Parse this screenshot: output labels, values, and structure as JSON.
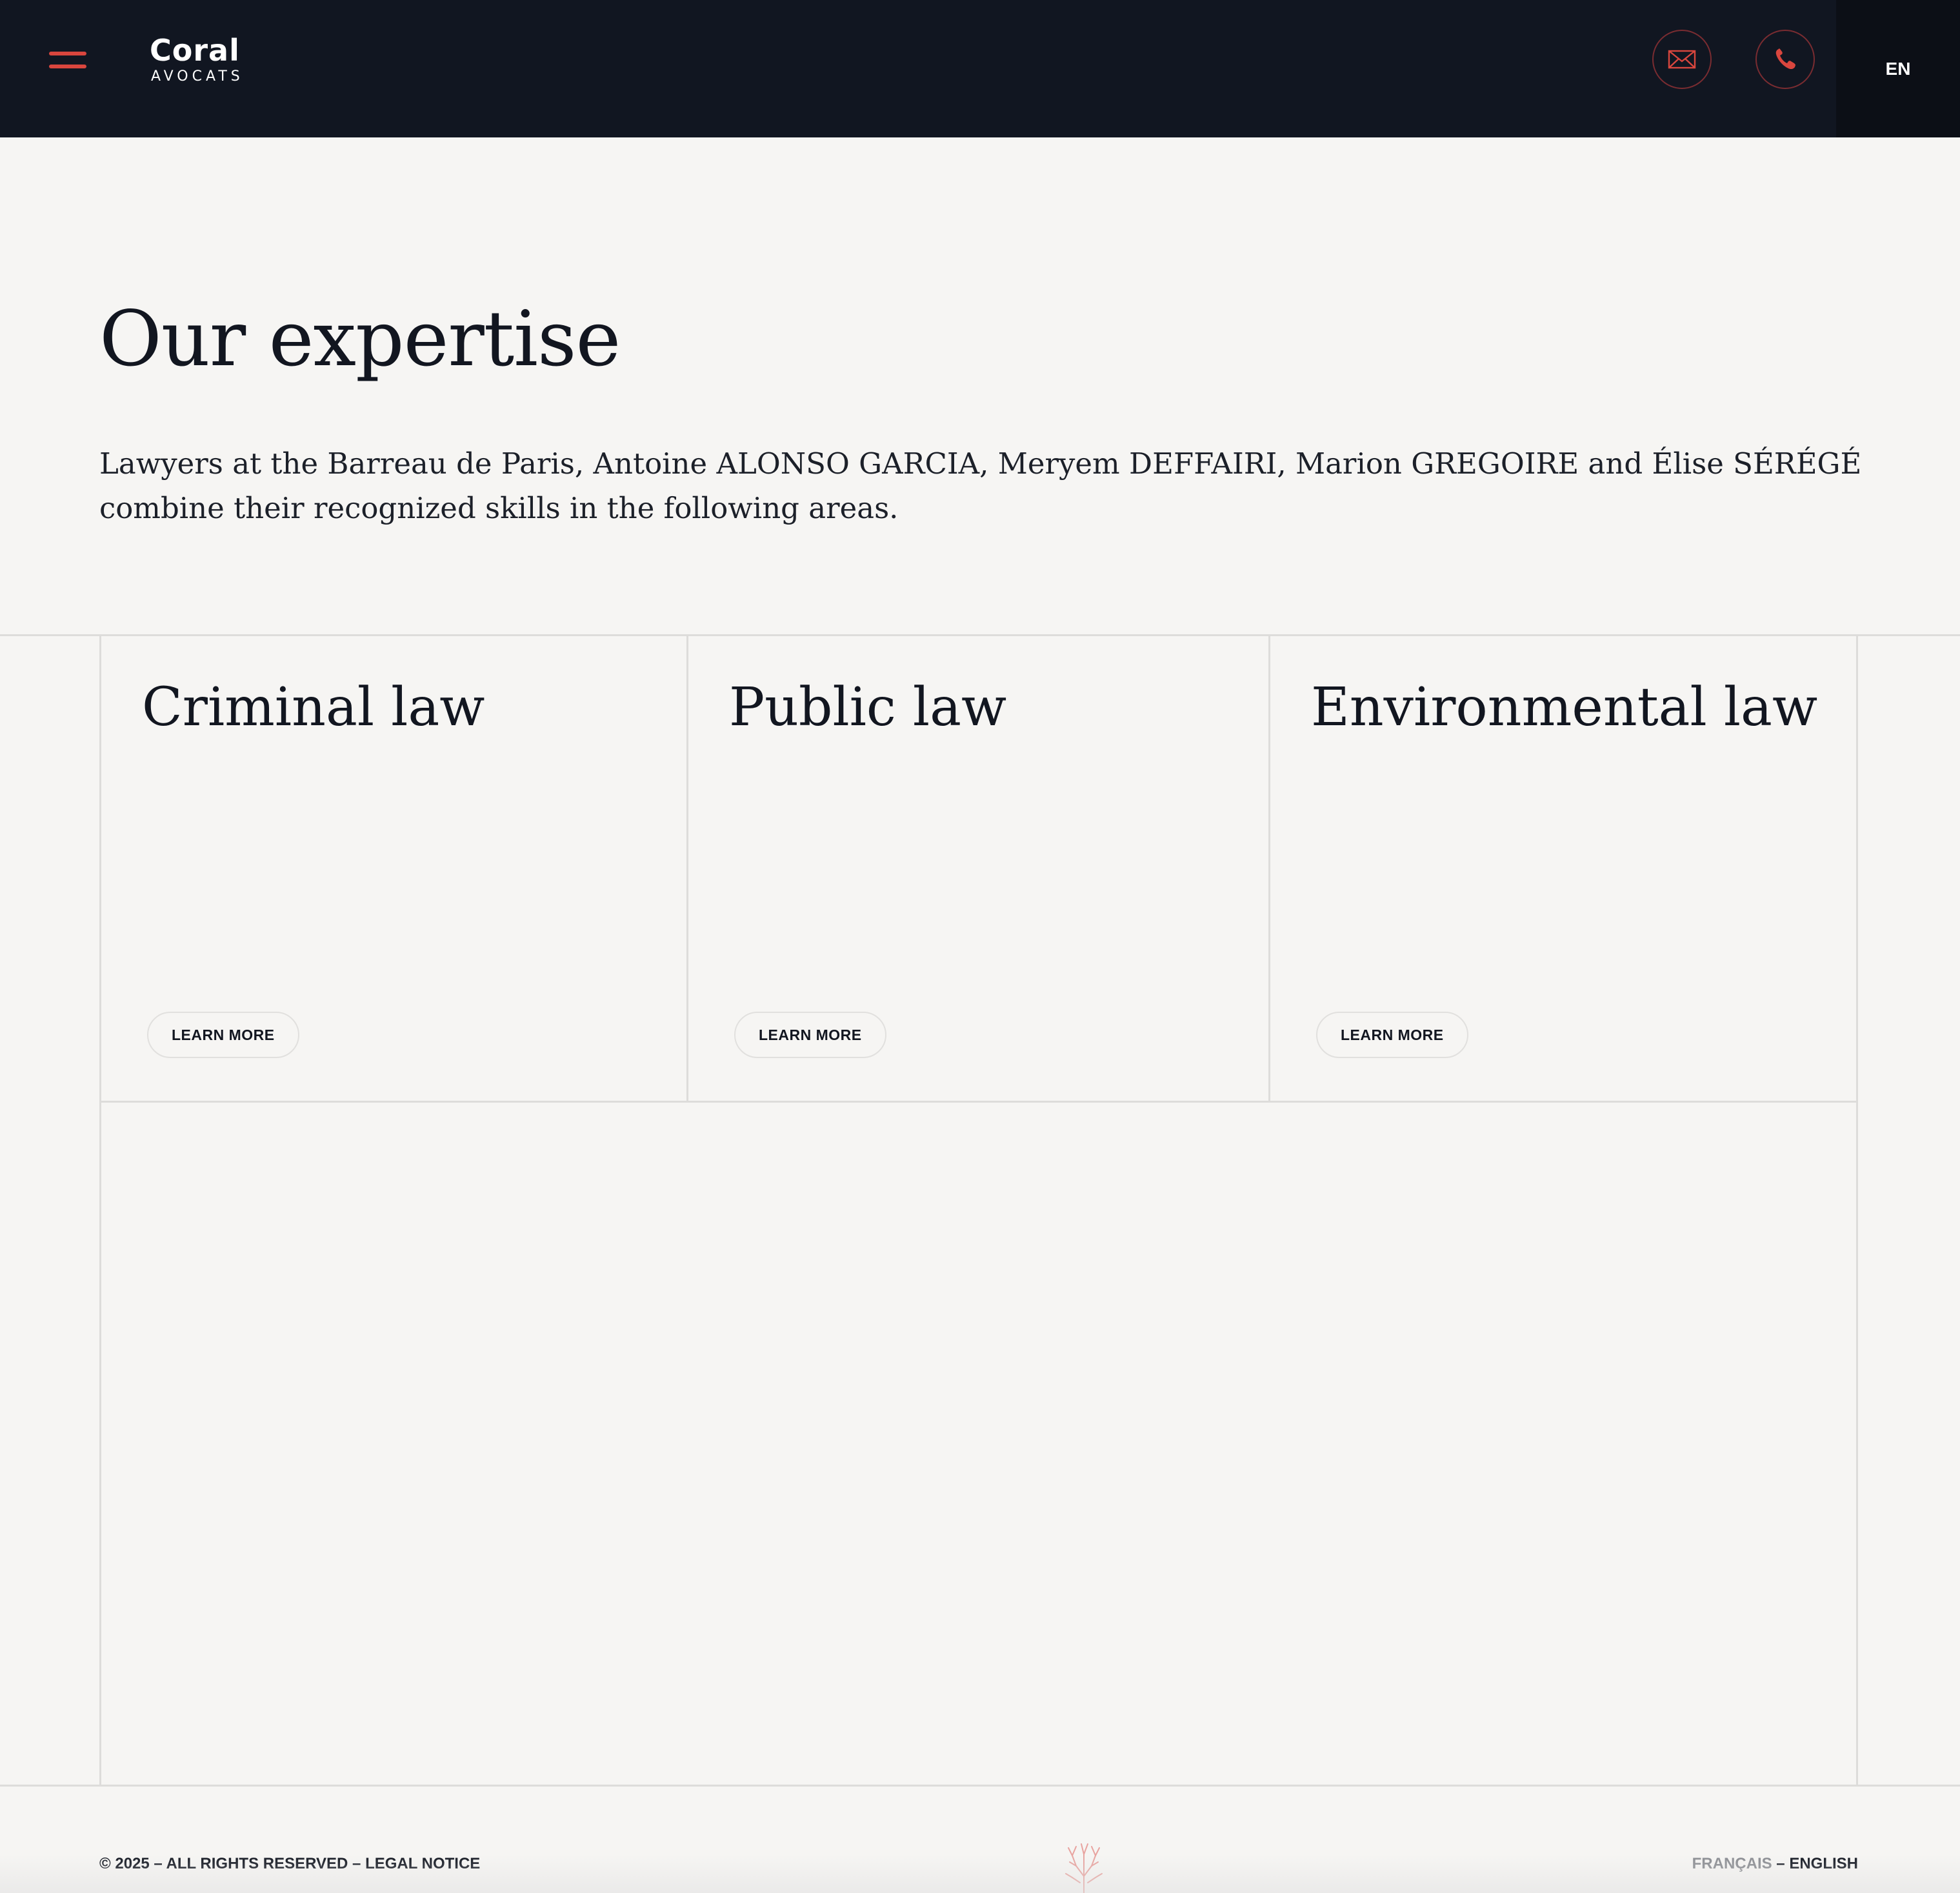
{
  "header": {
    "menu_icon": "hamburger-icon",
    "logo": {
      "name": "Coral",
      "subtitle": "AVOCATS"
    },
    "mail_icon": "envelope-icon",
    "phone_icon": "phone-icon",
    "language": "EN",
    "accent_color": "#d9463e",
    "background_color": "#111621"
  },
  "main": {
    "title": "Our expertise",
    "intro": "Lawyers at the Barreau de Paris, Antoine ALONSO GARCIA, Meryem DEFFAIRI, Marion GREGOIRE and Élise SÉRÉGÉ combine their recognized skills in the following areas.",
    "areas": [
      {
        "title": "Criminal law",
        "button": "LEARN MORE"
      },
      {
        "title": "Public law",
        "button": "LEARN MORE"
      },
      {
        "title": "Environmental law",
        "button": "LEARN MORE"
      }
    ]
  },
  "footer": {
    "copyright": "© 2025",
    "separator": " – ",
    "rights": "ALL RIGHTS RESERVED",
    "legal": "LEGAL NOTICE",
    "coral_icon": "coral-icon",
    "lang_fr": "FRANÇAIS",
    "lang_en": "ENGLISH"
  }
}
